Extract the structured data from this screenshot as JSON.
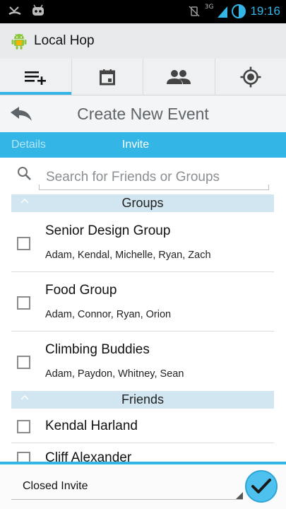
{
  "status_bar": {
    "time": "19:16",
    "network": "3G",
    "battery_level": "42"
  },
  "action_bar": {
    "title": "Local Hop",
    "icon": "android-robot-icon"
  },
  "tabs": [
    {
      "icon": "add-list-icon",
      "active": true
    },
    {
      "icon": "calendar-icon",
      "active": false
    },
    {
      "icon": "people-icon",
      "active": false
    },
    {
      "icon": "location-target-icon",
      "active": false
    }
  ],
  "sub_header": {
    "title": "Create New Event"
  },
  "steps": {
    "details_label": "Details",
    "invite_label": "Invite",
    "active": "invite"
  },
  "search": {
    "placeholder": "Search for Friends or Groups",
    "value": ""
  },
  "sections": {
    "groups_label": "Groups",
    "friends_label": "Friends"
  },
  "groups": [
    {
      "name": "Senior Design Group",
      "members": "Adam, Kendal, Michelle, Ryan, Zach",
      "checked": false
    },
    {
      "name": "Food Group",
      "members": "Adam, Connor, Ryan, Orion",
      "checked": false
    },
    {
      "name": "Climbing Buddies",
      "members": "Adam, Paydon, Whitney, Sean",
      "checked": false
    }
  ],
  "friends": [
    {
      "name": "Kendal Harland",
      "checked": false
    },
    {
      "name": "Cliff Alexander",
      "checked": false
    }
  ],
  "bottom_bar": {
    "invite_type": "Closed Invite"
  },
  "colors": {
    "accent": "#33b5e5",
    "section_header": "#d2e6f1",
    "action_bar": "#e8eaec"
  }
}
